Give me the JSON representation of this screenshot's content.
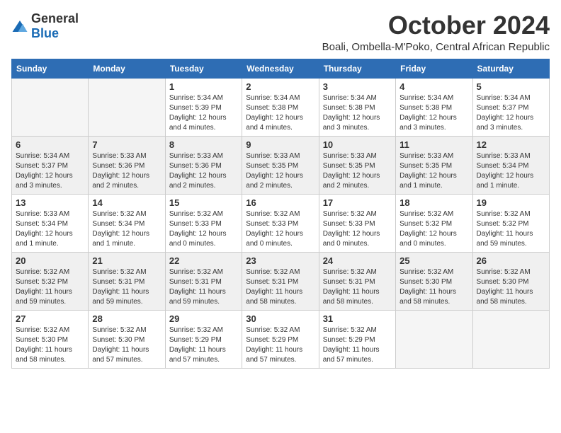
{
  "logo": {
    "text_general": "General",
    "text_blue": "Blue"
  },
  "title": "October 2024",
  "location": "Boali, Ombella-M'Poko, Central African Republic",
  "days_of_week": [
    "Sunday",
    "Monday",
    "Tuesday",
    "Wednesday",
    "Thursday",
    "Friday",
    "Saturday"
  ],
  "weeks": [
    [
      {
        "num": "",
        "detail": "",
        "empty": true
      },
      {
        "num": "",
        "detail": "",
        "empty": true
      },
      {
        "num": "1",
        "detail": "Sunrise: 5:34 AM\nSunset: 5:39 PM\nDaylight: 12 hours and 4 minutes."
      },
      {
        "num": "2",
        "detail": "Sunrise: 5:34 AM\nSunset: 5:38 PM\nDaylight: 12 hours and 4 minutes."
      },
      {
        "num": "3",
        "detail": "Sunrise: 5:34 AM\nSunset: 5:38 PM\nDaylight: 12 hours and 3 minutes."
      },
      {
        "num": "4",
        "detail": "Sunrise: 5:34 AM\nSunset: 5:38 PM\nDaylight: 12 hours and 3 minutes."
      },
      {
        "num": "5",
        "detail": "Sunrise: 5:34 AM\nSunset: 5:37 PM\nDaylight: 12 hours and 3 minutes."
      }
    ],
    [
      {
        "num": "6",
        "detail": "Sunrise: 5:34 AM\nSunset: 5:37 PM\nDaylight: 12 hours and 3 minutes."
      },
      {
        "num": "7",
        "detail": "Sunrise: 5:33 AM\nSunset: 5:36 PM\nDaylight: 12 hours and 2 minutes."
      },
      {
        "num": "8",
        "detail": "Sunrise: 5:33 AM\nSunset: 5:36 PM\nDaylight: 12 hours and 2 minutes."
      },
      {
        "num": "9",
        "detail": "Sunrise: 5:33 AM\nSunset: 5:35 PM\nDaylight: 12 hours and 2 minutes."
      },
      {
        "num": "10",
        "detail": "Sunrise: 5:33 AM\nSunset: 5:35 PM\nDaylight: 12 hours and 2 minutes."
      },
      {
        "num": "11",
        "detail": "Sunrise: 5:33 AM\nSunset: 5:35 PM\nDaylight: 12 hours and 1 minute."
      },
      {
        "num": "12",
        "detail": "Sunrise: 5:33 AM\nSunset: 5:34 PM\nDaylight: 12 hours and 1 minute."
      }
    ],
    [
      {
        "num": "13",
        "detail": "Sunrise: 5:33 AM\nSunset: 5:34 PM\nDaylight: 12 hours and 1 minute."
      },
      {
        "num": "14",
        "detail": "Sunrise: 5:32 AM\nSunset: 5:34 PM\nDaylight: 12 hours and 1 minute."
      },
      {
        "num": "15",
        "detail": "Sunrise: 5:32 AM\nSunset: 5:33 PM\nDaylight: 12 hours and 0 minutes."
      },
      {
        "num": "16",
        "detail": "Sunrise: 5:32 AM\nSunset: 5:33 PM\nDaylight: 12 hours and 0 minutes."
      },
      {
        "num": "17",
        "detail": "Sunrise: 5:32 AM\nSunset: 5:33 PM\nDaylight: 12 hours and 0 minutes."
      },
      {
        "num": "18",
        "detail": "Sunrise: 5:32 AM\nSunset: 5:32 PM\nDaylight: 12 hours and 0 minutes."
      },
      {
        "num": "19",
        "detail": "Sunrise: 5:32 AM\nSunset: 5:32 PM\nDaylight: 11 hours and 59 minutes."
      }
    ],
    [
      {
        "num": "20",
        "detail": "Sunrise: 5:32 AM\nSunset: 5:32 PM\nDaylight: 11 hours and 59 minutes."
      },
      {
        "num": "21",
        "detail": "Sunrise: 5:32 AM\nSunset: 5:31 PM\nDaylight: 11 hours and 59 minutes."
      },
      {
        "num": "22",
        "detail": "Sunrise: 5:32 AM\nSunset: 5:31 PM\nDaylight: 11 hours and 59 minutes."
      },
      {
        "num": "23",
        "detail": "Sunrise: 5:32 AM\nSunset: 5:31 PM\nDaylight: 11 hours and 58 minutes."
      },
      {
        "num": "24",
        "detail": "Sunrise: 5:32 AM\nSunset: 5:31 PM\nDaylight: 11 hours and 58 minutes."
      },
      {
        "num": "25",
        "detail": "Sunrise: 5:32 AM\nSunset: 5:30 PM\nDaylight: 11 hours and 58 minutes."
      },
      {
        "num": "26",
        "detail": "Sunrise: 5:32 AM\nSunset: 5:30 PM\nDaylight: 11 hours and 58 minutes."
      }
    ],
    [
      {
        "num": "27",
        "detail": "Sunrise: 5:32 AM\nSunset: 5:30 PM\nDaylight: 11 hours and 58 minutes."
      },
      {
        "num": "28",
        "detail": "Sunrise: 5:32 AM\nSunset: 5:30 PM\nDaylight: 11 hours and 57 minutes."
      },
      {
        "num": "29",
        "detail": "Sunrise: 5:32 AM\nSunset: 5:29 PM\nDaylight: 11 hours and 57 minutes."
      },
      {
        "num": "30",
        "detail": "Sunrise: 5:32 AM\nSunset: 5:29 PM\nDaylight: 11 hours and 57 minutes."
      },
      {
        "num": "31",
        "detail": "Sunrise: 5:32 AM\nSunset: 5:29 PM\nDaylight: 11 hours and 57 minutes."
      },
      {
        "num": "",
        "detail": "",
        "empty": true
      },
      {
        "num": "",
        "detail": "",
        "empty": true
      }
    ]
  ]
}
